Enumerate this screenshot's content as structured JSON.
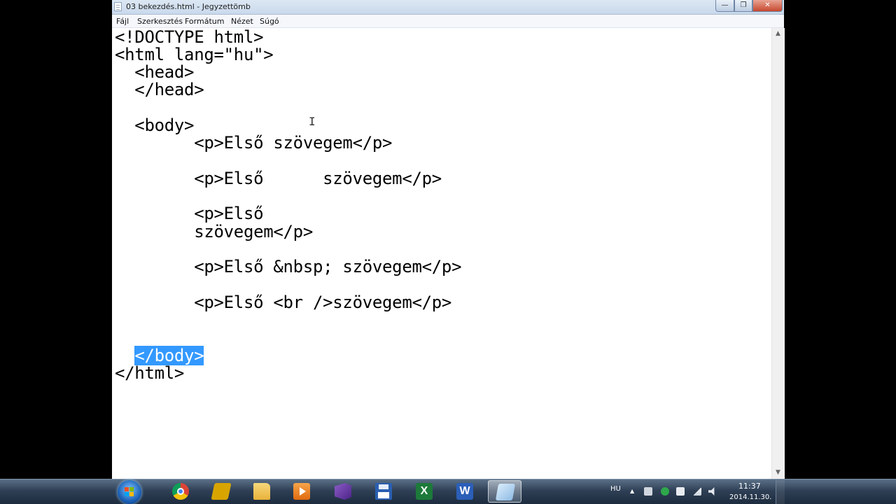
{
  "window": {
    "title": "03 bekezdés.html - Jegyzettömb",
    "controls": {
      "minimize": "—",
      "maximize": "❐",
      "close": "✕"
    }
  },
  "menu": [
    "Fájl",
    "Szerkesztés",
    "Formátum",
    "Nézet",
    "Súgó"
  ],
  "editor": {
    "lines": [
      "<!DOCTYPE html>",
      "<html lang=\"hu\">",
      "  <head>",
      "  </head>",
      "",
      "  <body>",
      "        <p>Első szövegem</p>",
      "",
      "        <p>Első      szövegem</p>",
      "",
      "        <p>Első",
      "        szövegem</p>",
      "",
      "        <p>Első &nbsp; szövegem</p>",
      "",
      "        <p>Első <br />szövegem</p>",
      "",
      "",
      "  </body>",
      "</html>"
    ],
    "selected_text": "</body>",
    "selection_line_prefix": "  "
  },
  "taskbar": {
    "apps": [
      {
        "name": "chrome-icon",
        "color": "#e8b020"
      },
      {
        "name": "filezilla-icon",
        "color": "#d8a400"
      },
      {
        "name": "explorer-folder-icon",
        "color": "#f2c24f"
      },
      {
        "name": "media-player-icon",
        "color": "#ef8a1a"
      },
      {
        "name": "visual-studio-icon",
        "color": "#6d3aa8"
      },
      {
        "name": "save-floppy-icon",
        "color": "#2a5fb0"
      },
      {
        "name": "excel-icon",
        "color": "#1d7a3a"
      },
      {
        "name": "word-icon",
        "color": "#2b5fb8"
      },
      {
        "name": "notepad-icon",
        "color": "#9fc4e8"
      }
    ],
    "language": "HU",
    "time": "11:37",
    "date": "2014.11.30."
  }
}
